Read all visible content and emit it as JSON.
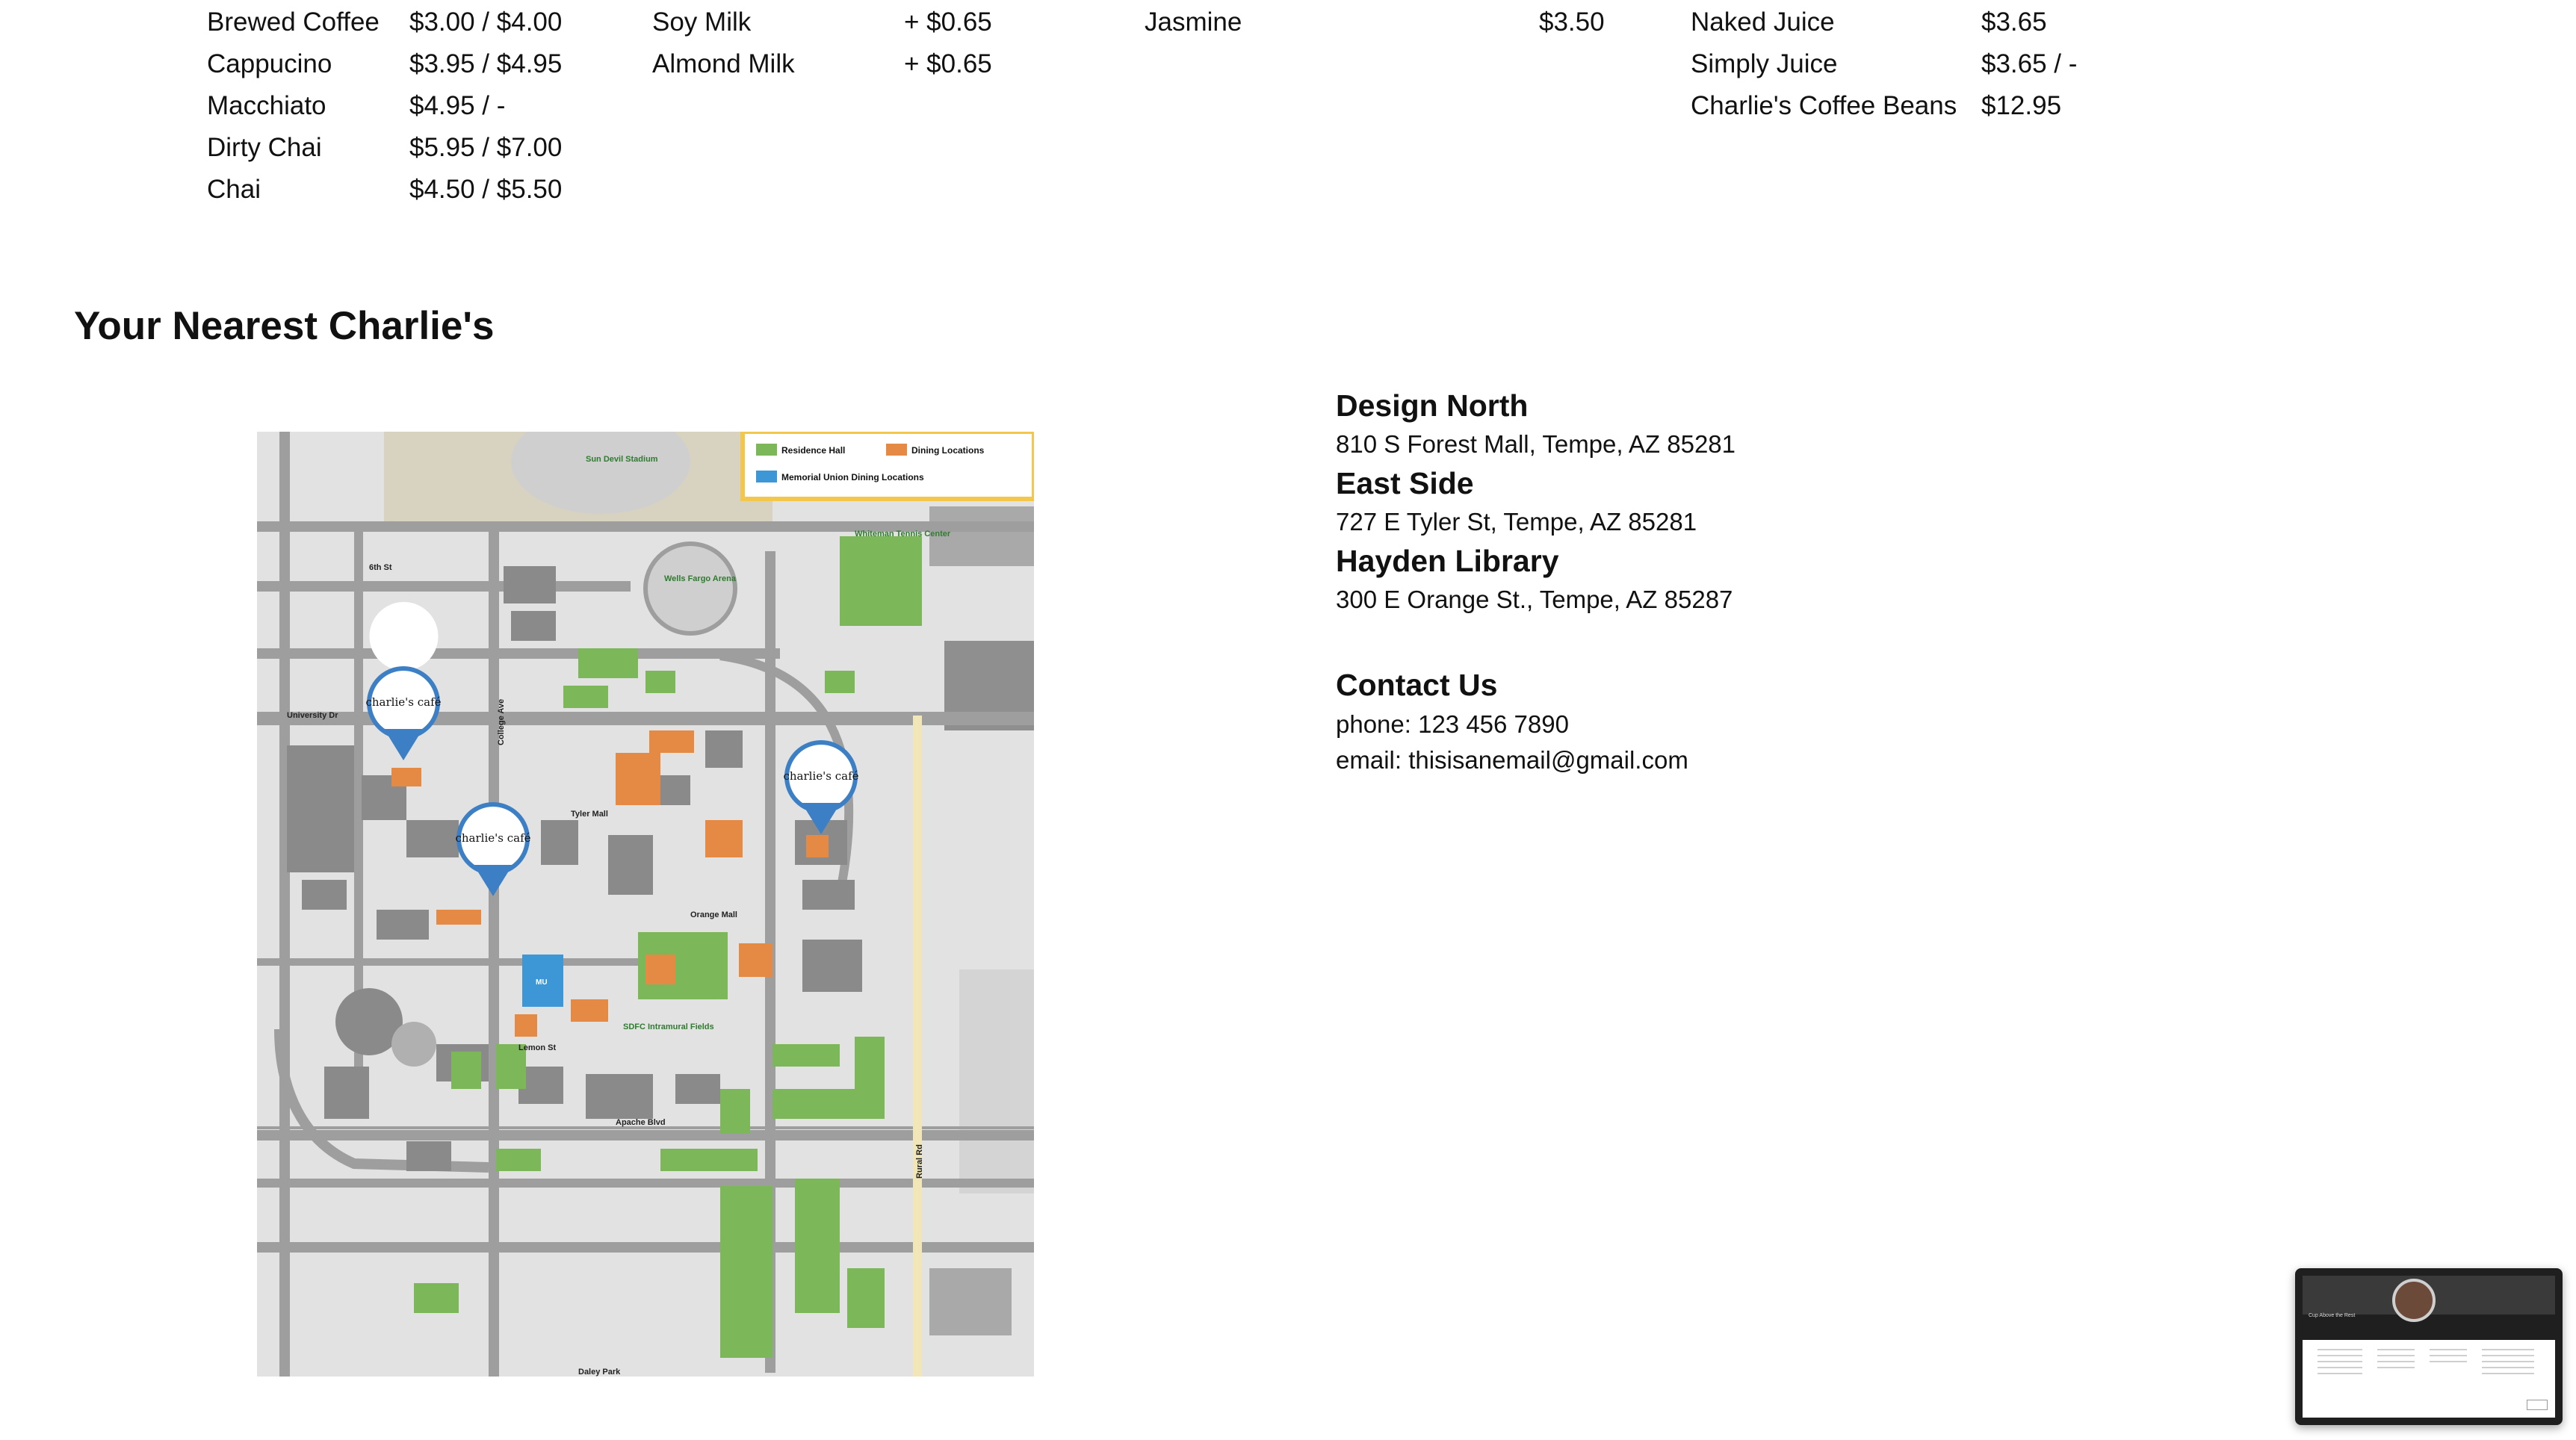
{
  "menu": {
    "coffee": [
      {
        "name": "Brewed Coffee",
        "price": "$3.00 / $4.00"
      },
      {
        "name": "Cappucino",
        "price": "$3.95 / $4.95"
      },
      {
        "name": "Macchiato",
        "price": "$4.95 / -"
      },
      {
        "name": "Dirty Chai",
        "price": "$5.95 / $7.00"
      },
      {
        "name": "Chai",
        "price": "$4.50 / $5.50"
      }
    ],
    "addons": [
      {
        "name": "Soy Milk",
        "price": "+ $0.65"
      },
      {
        "name": "Almond Milk",
        "price": "+ $0.65"
      }
    ],
    "tea": [
      {
        "name": "Jasmine",
        "price": "$3.50"
      }
    ],
    "other": [
      {
        "name": "Naked Juice",
        "price": "$3.65"
      },
      {
        "name": "Simply Juice",
        "price": "$3.65 / -"
      },
      {
        "name": "Charlie's Coffee Beans",
        "price": "$12.95"
      }
    ]
  },
  "nearest": {
    "title": "Your Nearest Charlie's",
    "locations": [
      {
        "name": "Design North",
        "address": "810 S Forest Mall, Tempe, AZ 85281"
      },
      {
        "name": "East Side",
        "address": "727 E Tyler St, Tempe, AZ 85281"
      },
      {
        "name": "Hayden Library",
        "address": "300 E Orange St., Tempe, AZ 85287"
      }
    ]
  },
  "contact": {
    "title": "Contact Us",
    "phone": "phone: 123 456 7890",
    "email": "email: thisisanemail@gmail.com"
  },
  "map": {
    "legend": {
      "residence": "Residence Hall",
      "dining": "Dining Locations",
      "memorial": "Memorial Union Dining Locations"
    },
    "colors": {
      "residence": "#7cb85a",
      "dining": "#e58a44",
      "memorial": "#3d97d6",
      "road": "#9e9e9e",
      "building": "#8a8a8a",
      "legend_border": "#f3c74c"
    },
    "pin_label": "charlie's café",
    "labels": {
      "stadium": "Sun Devil Stadium",
      "wells": "Wells Fargo Arena",
      "whiteman": "Whiteman Tennis Center",
      "university": "University Dr",
      "apache": "Apache Blvd",
      "orange": "Orange Mall",
      "lemon": "Lemon St",
      "rural": "Rural Rd",
      "college": "College Ave",
      "sixth": "6th St",
      "tyler": "Tyler Mall",
      "sdfc": "SDFC Intramural Fields",
      "mu": "MU",
      "daley": "Daley Park"
    }
  },
  "thumbnail": {
    "caption": "Cup Above the Rest"
  }
}
